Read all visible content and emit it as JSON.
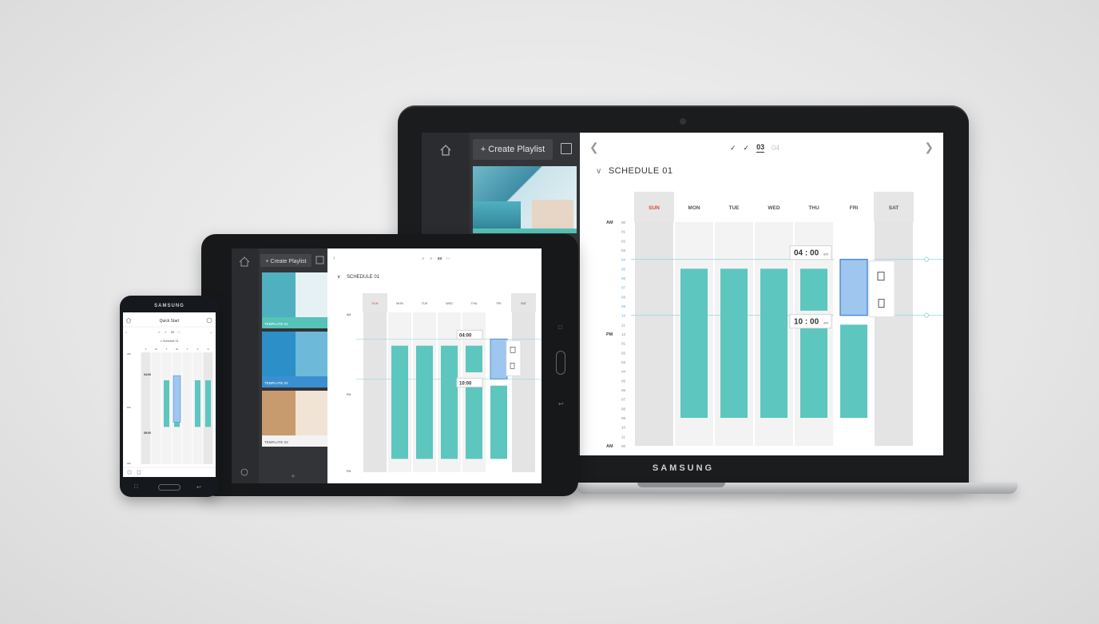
{
  "laptop": {
    "brand": "SAMSUNG",
    "sidebar": {
      "create_playlist": "+ Create Playlist"
    },
    "steps": [
      "✓",
      "✓",
      "03",
      "04"
    ],
    "schedule_title": "SCHEDULE 01",
    "days": [
      "SUN",
      "MON",
      "TUE",
      "WED",
      "THU",
      "FRI",
      "SAT"
    ],
    "hours": [
      "00",
      "01",
      "02",
      "03",
      "04",
      "05",
      "06",
      "07",
      "08",
      "09",
      "10",
      "11",
      "12",
      "01",
      "02",
      "03",
      "04",
      "05",
      "06",
      "07",
      "08",
      "09",
      "10",
      "11",
      "00"
    ],
    "am_label": "AM",
    "pm_label": "PM",
    "start_time": "04 : 00",
    "end_time": "10 : 00",
    "time_suffix": "am"
  },
  "tablet": {
    "sidebar": {
      "create_playlist": "+ Create Playlist"
    },
    "steps": [
      "✓",
      "✓",
      "03",
      "04"
    ],
    "schedule_title": "SCHEDULE 01",
    "days": [
      "SUN",
      "MON",
      "TUE",
      "WED",
      "THU",
      "FRI",
      "SAT"
    ],
    "templates": [
      "TEMPLATE 01",
      "TEMPLATE 02",
      "TEMPLATE 03"
    ],
    "start_time": "04:00",
    "end_time": "10:00",
    "am_label": "AM",
    "pm_label": "PM"
  },
  "phone": {
    "brand": "SAMSUNG",
    "title": "Quick Start",
    "schedule_title": "Schedule 01",
    "steps": [
      "✓",
      "✓",
      "03",
      "04"
    ],
    "days": [
      "S",
      "M",
      "T",
      "W",
      "T",
      "F",
      "S"
    ],
    "start_time": "04:00",
    "end_time": "08:00",
    "am_label": "AM",
    "pm_label": "PM"
  },
  "colors": {
    "bar": "#5cc6bf",
    "selected": "#9ec6ee",
    "selected_border": "#4f8fd9",
    "sunday": "#e0453a"
  }
}
